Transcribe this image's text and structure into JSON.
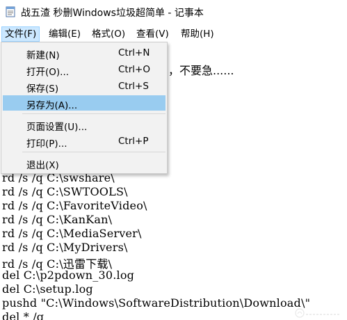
{
  "window": {
    "title": "战五渣 秒删Windows垃圾超简单 - 记事本"
  },
  "menubar": {
    "items": [
      {
        "label": "文件(F)"
      },
      {
        "label": "编辑(E)"
      },
      {
        "label": "格式(O)"
      },
      {
        "label": "查看(V)"
      },
      {
        "label": "帮助(H)"
      }
    ]
  },
  "file_menu": {
    "items": [
      {
        "label": "新建(N)",
        "shortcut": "Ctrl+N"
      },
      {
        "label": "打开(O)...",
        "shortcut": "Ctrl+O"
      },
      {
        "label": "保存(S)",
        "shortcut": "Ctrl+S"
      },
      {
        "label": "另存为(A)...",
        "shortcut": ""
      },
      {
        "label": "页面设置(U)...",
        "shortcut": ""
      },
      {
        "label": "打印(P)...",
        "shortcut": "Ctrl+P"
      },
      {
        "label": "退出(X)",
        "shortcut": ""
      }
    ],
    "highlighted": "另存为(A)..."
  },
  "editor": {
    "partial_visible_text": "，不要急......",
    "lines": [
      "rd /s /q C:\\swshare\\",
      "rd /s /q C:\\SWTOOLS\\",
      "rd /s /q C:\\FavoriteVideo\\",
      "rd /s /q C:\\KanKan\\",
      "rd /s /q C:\\MediaServer\\",
      "rd /s /q C:\\MyDrivers\\",
      "rd /s /q C:\\迅雷下载\\",
      "del C:\\p2pdown_30.log",
      "del C:\\setup.log",
      "pushd \"C:\\Windows\\SoftwareDistribution\\Download\\\"",
      "del * /q"
    ]
  },
  "colors": {
    "menu_highlight": "#99ccf0",
    "menu_active_bg": "#cce8ff",
    "dropdown_bg": "#f2f2f2"
  }
}
